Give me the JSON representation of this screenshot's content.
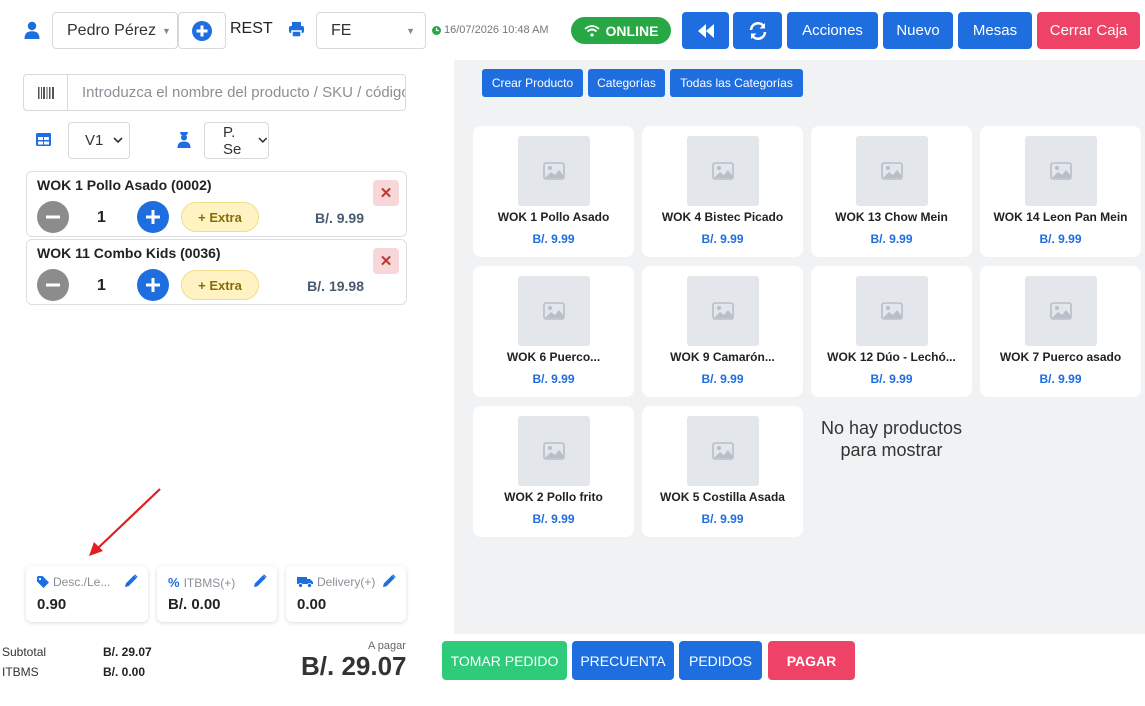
{
  "header": {
    "user_name": "Pedro Pérez",
    "service_type": "REST",
    "invoice_type": "FE",
    "datetime": "16/07/2026 10:48 AM",
    "status": "ONLINE",
    "buttons": {
      "acciones": "Acciones",
      "nuevo": "Nuevo",
      "mesas": "Mesas",
      "cerrar_caja": "Cerrar Caja"
    }
  },
  "search": {
    "placeholder": "Introduzca el nombre del producto / SKU / código"
  },
  "selectors": {
    "table": "V1",
    "waiter": "P. Se"
  },
  "order_lines": [
    {
      "name": "WOK 1 Pollo Asado (0002)",
      "qty": "1",
      "extra_label": "+ Extra",
      "price": "B/. 9.99"
    },
    {
      "name": "WOK 11 Combo Kids (0036)",
      "qty": "1",
      "extra_label": "+ Extra",
      "price": "B/. 19.98"
    }
  ],
  "summary": {
    "discount": {
      "label": "Desc./Le...",
      "value": "0.90"
    },
    "itbms": {
      "label": "ITBMS(+)",
      "value": "B/. 0.00"
    },
    "delivery": {
      "label": "Delivery(+)",
      "value": "0.00"
    }
  },
  "tabs": {
    "crear_producto": "Crear Producto",
    "categorias": "Categorías",
    "todas": "Todas las Categorías"
  },
  "products": [
    {
      "name": "WOK 1 Pollo Asado",
      "price": "B/. 9.99"
    },
    {
      "name": "WOK 4 Bistec Picado",
      "price": "B/. 9.99"
    },
    {
      "name": "WOK 13 Chow Mein",
      "price": "B/. 9.99"
    },
    {
      "name": "WOK 14 Leon Pan Mein",
      "price": "B/. 9.99"
    },
    {
      "name": "WOK 6 Puerco...",
      "price": "B/. 9.99"
    },
    {
      "name": "WOK 9 Camarón...",
      "price": "B/. 9.99"
    },
    {
      "name": "WOK 12 Dúo - Lechó...",
      "price": "B/. 9.99"
    },
    {
      "name": "WOK 7 Puerco asado",
      "price": "B/. 9.99"
    },
    {
      "name": "WOK 2 Pollo frito",
      "price": "B/. 9.99"
    },
    {
      "name": "WOK 5 Costilla Asada",
      "price": "B/. 9.99"
    }
  ],
  "no_products_text": "No hay productos para mostrar",
  "footer": {
    "subtotal_label": "Subtotal",
    "subtotal_value": "B/. 29.07",
    "itbms_label": "ITBMS",
    "itbms_value": "B/. 0.00",
    "to_pay_label": "A pagar",
    "to_pay_value": "B/. 29.07",
    "buttons": {
      "tomar_pedido": "TOMAR PEDIDO",
      "precuenta": "PRECUENTA",
      "pedidos": "PEDIDOS",
      "pagar": "PAGAR"
    }
  },
  "colors": {
    "primary": "#1e6ee0",
    "danger": "#ee4266",
    "success": "#28a745",
    "order_green": "#2ecc7a",
    "panel_bg": "#f1f2f4"
  }
}
